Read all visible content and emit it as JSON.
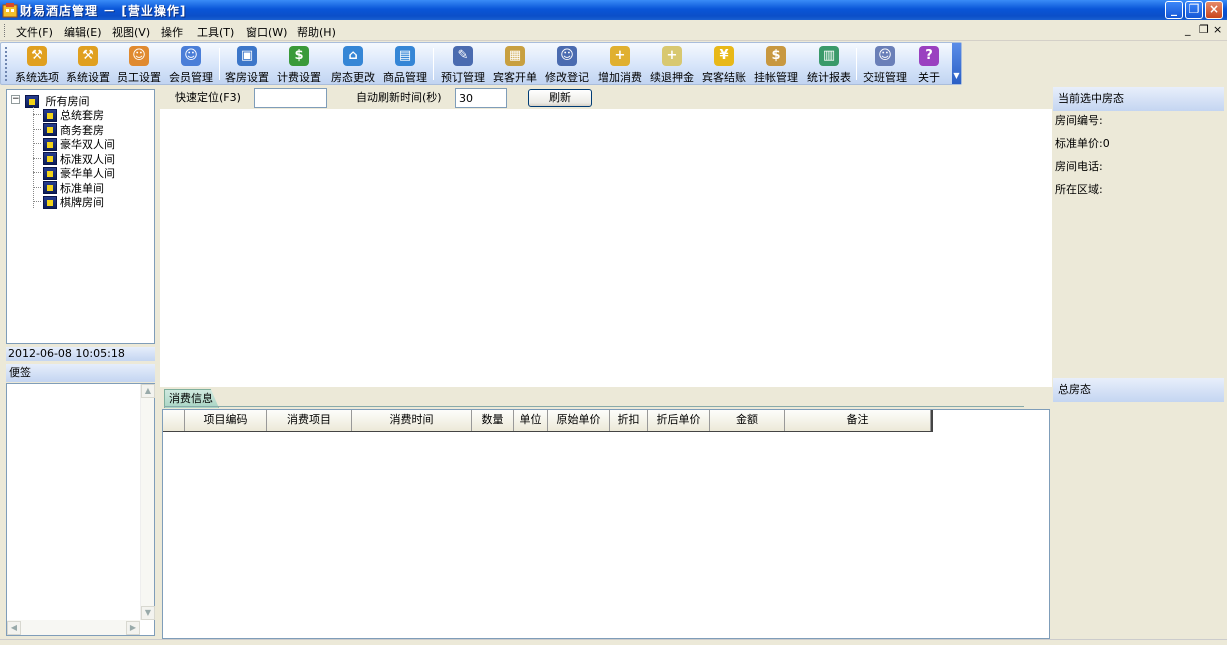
{
  "window": {
    "title": "财易酒店管理 － [营业操作]"
  },
  "menu": {
    "items": [
      "文件(F)",
      "编辑(E)",
      "视图(V)",
      "操作",
      "工具(T)",
      "窗口(W)",
      "帮助(H)"
    ],
    "mdi_controls": [
      "_",
      "❐",
      "×"
    ]
  },
  "toolbar": {
    "buttons": [
      {
        "label": "系统选项",
        "icon": "hammer-icon",
        "color": "#e0a020"
      },
      {
        "label": "系统设置",
        "icon": "hammer-icon",
        "color": "#e0a020"
      },
      {
        "label": "员工设置",
        "icon": "person-icon",
        "color": "#e08a30"
      },
      {
        "label": "会员管理",
        "icon": "person-icon",
        "color": "#4a7ed8"
      },
      {
        "label": "客房设置",
        "icon": "room-icon",
        "color": "#3c76c9"
      },
      {
        "label": "计费设置",
        "icon": "money-icon",
        "color": "#3a9a3a"
      },
      {
        "label": "房态更改",
        "icon": "house-icon",
        "color": "#3586d6"
      },
      {
        "label": "商品管理",
        "icon": "box-icon",
        "color": "#3586d6"
      },
      {
        "label": "预订管理",
        "icon": "stapler-icon",
        "color": "#4a6bb0"
      },
      {
        "label": "宾客开单",
        "icon": "package-icon",
        "color": "#c8a040"
      },
      {
        "label": "修改登记",
        "icon": "user-edit-icon",
        "color": "#4a6bb0"
      },
      {
        "label": "增加消费",
        "icon": "add-cost-icon",
        "color": "#e0b030"
      },
      {
        "label": "续退押金",
        "icon": "deposit-icon",
        "color": "#d8c870"
      },
      {
        "label": "宾客结账",
        "icon": "yen-icon",
        "color": "#e8b818"
      },
      {
        "label": "挂帐管理",
        "icon": "moneybag-icon",
        "color": "#c89840"
      },
      {
        "label": "统计报表",
        "icon": "bar-chart-icon",
        "color": "#3a9a6a"
      },
      {
        "label": "交班管理",
        "icon": "users-icon",
        "color": "#6a7fb8"
      },
      {
        "label": "关于",
        "icon": "help-icon",
        "color": "#9a40c0"
      }
    ]
  },
  "tree": {
    "root": "所有房间",
    "expander": "−",
    "children": [
      "总统套房",
      "商务套房",
      "豪华双人间",
      "标准双人间",
      "豪华单人间",
      "标准单间",
      "棋牌房间"
    ]
  },
  "datetime": "2012-06-08 10:05:18",
  "notes": {
    "title": "便签"
  },
  "filter": {
    "quick_locate_label": "快速定位(F3)",
    "quick_locate_value": "",
    "auto_refresh_label": "自动刷新时间(秒)",
    "auto_refresh_value": "30",
    "refresh_button": "刷新"
  },
  "consumption": {
    "tab": "消费信息",
    "columns": [
      "",
      "项目编码",
      "消费项目",
      "消费时间",
      "数量",
      "单位",
      "原始单价",
      "折扣",
      "折后单价",
      "金额",
      "备注"
    ]
  },
  "room_status": {
    "current_title": "当前选中房态",
    "fields": [
      "房间编号:",
      "标准单价:0",
      "房间电话:",
      "所在区域:"
    ],
    "total_title": "总房态"
  }
}
